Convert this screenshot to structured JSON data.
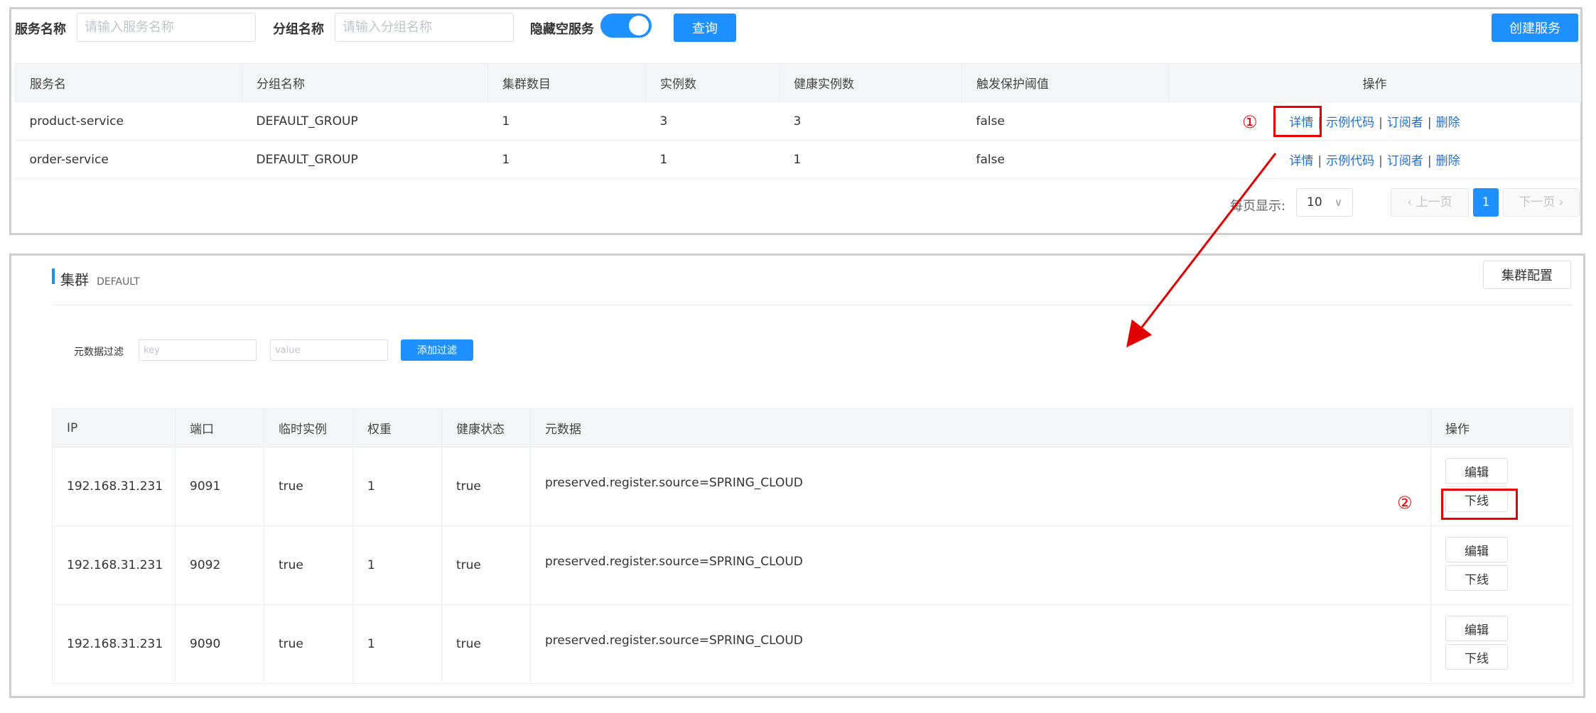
{
  "search": {
    "service_name_label": "服务名称",
    "service_name_placeholder": "请输入服务名称",
    "group_name_label": "分组名称",
    "group_name_placeholder": "请输入分组名称",
    "hide_empty_label": "隐藏空服务",
    "hide_empty_enabled": true,
    "query_button": "查询",
    "create_button": "创建服务"
  },
  "services_table": {
    "headers": [
      "服务名",
      "分组名称",
      "集群数目",
      "实例数",
      "健康实例数",
      "触发保护阈值",
      "操作"
    ],
    "rows": [
      {
        "name": "product-service",
        "group": "DEFAULT_GROUP",
        "clusters": "1",
        "instances": "3",
        "healthy": "3",
        "threshold": "false"
      },
      {
        "name": "order-service",
        "group": "DEFAULT_GROUP",
        "clusters": "1",
        "instances": "1",
        "healthy": "1",
        "threshold": "false"
      }
    ],
    "actions": {
      "detail": "详情",
      "sample_code": "示例代码",
      "subscribers": "订阅者",
      "delete": "删除",
      "separator": "|"
    }
  },
  "pagination": {
    "page_size_label": "每页显示:",
    "page_size": "10",
    "prev": "上一页",
    "current_page": "1",
    "next": "下一页"
  },
  "cluster": {
    "title": "集群",
    "name": "DEFAULT",
    "config_button": "集群配置",
    "filter_label": "元数据过滤",
    "key_placeholder": "key",
    "value_placeholder": "value",
    "add_filter_button": "添加过滤"
  },
  "instances_table": {
    "headers": [
      "IP",
      "端口",
      "临时实例",
      "权重",
      "健康状态",
      "元数据",
      "操作"
    ],
    "rows": [
      {
        "ip": "192.168.31.231",
        "port": "9091",
        "ephemeral": "true",
        "weight": "1",
        "healthy": "true",
        "metadata": "preserved.register.source=SPRING_CLOUD"
      },
      {
        "ip": "192.168.31.231",
        "port": "9092",
        "ephemeral": "true",
        "weight": "1",
        "healthy": "true",
        "metadata": "preserved.register.source=SPRING_CLOUD"
      },
      {
        "ip": "192.168.31.231",
        "port": "9090",
        "ephemeral": "true",
        "weight": "1",
        "healthy": "true",
        "metadata": "preserved.register.source=SPRING_CLOUD"
      }
    ],
    "actions": {
      "edit": "编辑",
      "offline": "下线"
    }
  },
  "annotations": {
    "step1": "①",
    "step2": "②",
    "color": "#e00000"
  },
  "colors": {
    "primary": "#1e90ff",
    "link": "#1e6fd9",
    "border": "#cfcfcf"
  }
}
